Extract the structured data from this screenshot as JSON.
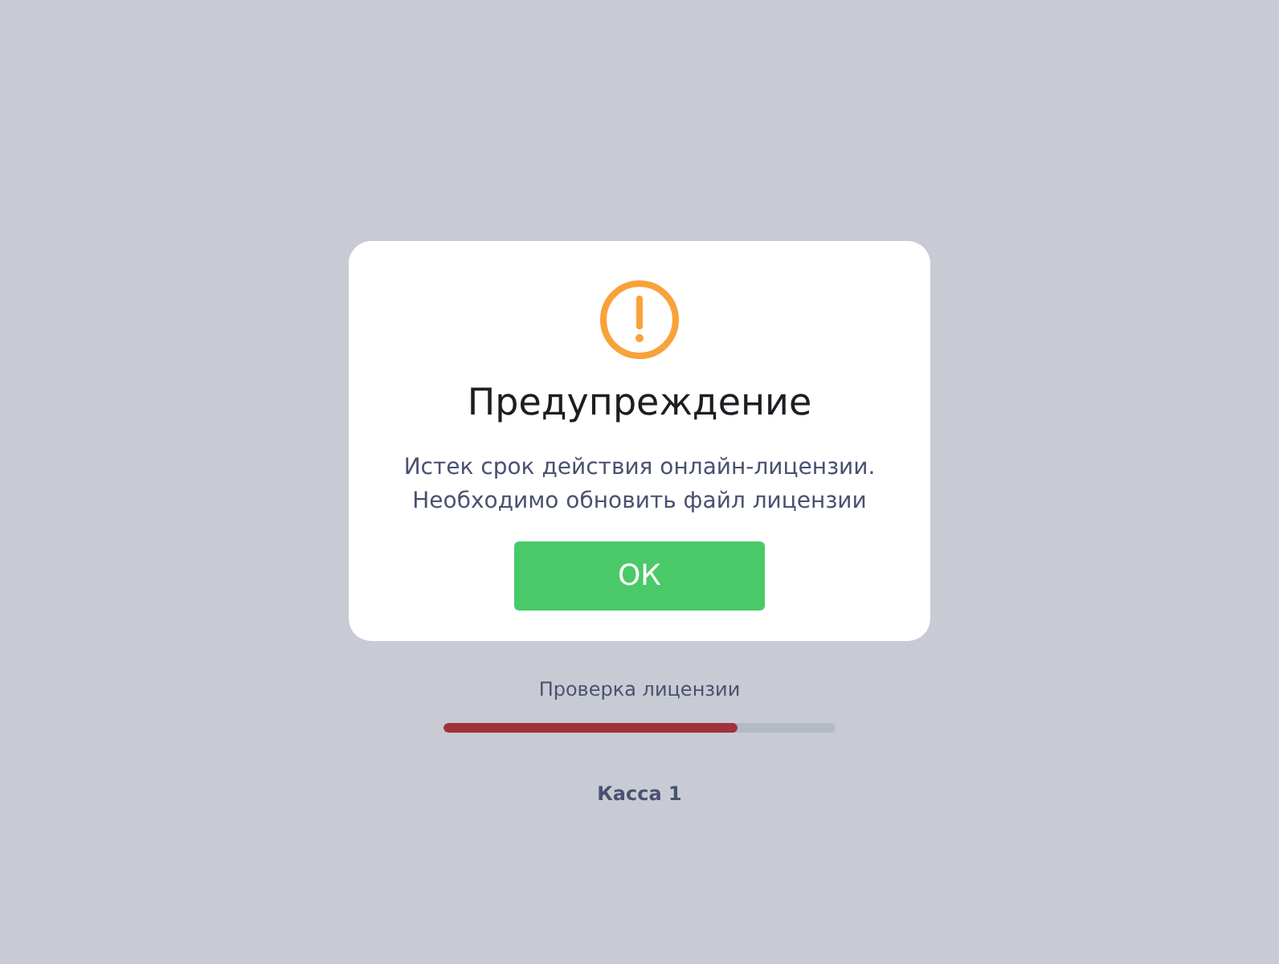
{
  "dialog": {
    "title": "Предупреждение",
    "message": "Истек срок действия онлайн-лицензии.\nНеобходимо обновить файл лицензии",
    "button": "ОК"
  },
  "progress": {
    "label": "Проверка лицензии",
    "level": 0.75
  },
  "footer": "Касса 1"
}
